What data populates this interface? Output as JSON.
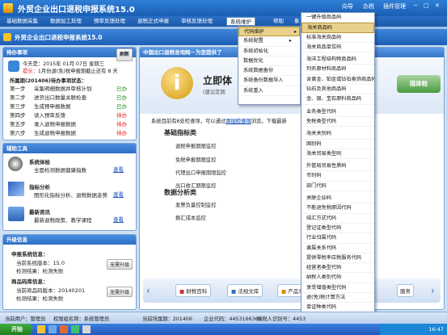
{
  "app": {
    "title": "外贸企业出口退税申报系统15.0",
    "right_links": [
      "向导",
      "办税",
      "插件管理"
    ]
  },
  "menu": {
    "items": [
      "基础数据采集",
      "数据加工处理",
      "预审反馈处理",
      "退税正式申报",
      "审核反馈处理",
      "系统维护",
      "帮助",
      "象"
    ]
  },
  "dropdown1": {
    "items": [
      "代码维护",
      "系统配置",
      "系统初始化",
      "数据优化",
      "系统数据备份",
      "系统备份数据导入",
      "系统重入"
    ]
  },
  "dropdown2": {
    "items": [
      "一键升级商品码",
      "海关商品码",
      "标准海关商品码",
      "海关商品单位码",
      "海洋工程结构物商品码",
      "列名原材料商品码",
      "含黄金、铂金或钻石类饰商品码",
      "钻石及其他商品码",
      "金、银、宝石原料商品码",
      "业务类型代码",
      "免税类型代码",
      "海关关别码",
      "国别码",
      "海关贸易类型码",
      "外管局贸易性质码",
      "币别码",
      "部门代码",
      "关联企业码",
      "不能退免税原因代码",
      "结汇方式代码",
      "登记证类型代码",
      "行业归属代码",
      "隶属关系代码",
      "提供零税率应税服务代码",
      "经营者类型代码",
      "纳税人类别代码",
      "享受增值类型代码",
      "退(免)税计算方法",
      "单证种类代码"
    ],
    "highlight_index": 1
  },
  "left": {
    "tasks": {
      "title": "待办事项",
      "refresh": "刷新",
      "today": "今天是：2015年 01月 07日 星期三",
      "reminder_prefix": "提示：",
      "reminder": "1月份退(免)税申报期截止还有 8 天",
      "period_label": "所属期(201406)待办事项状态：",
      "steps": [
        {
          "name": "第一步",
          "text": "采集明细数据并审核计划",
          "status": "已办"
        },
        {
          "name": "第二步",
          "text": "进货出口数量关联检查",
          "status": "已办"
        },
        {
          "name": "第三步",
          "text": "生成预申报数据",
          "status": "已办"
        },
        {
          "name": "第四步",
          "text": "读入预审反馈",
          "status": "待办"
        },
        {
          "name": "第五步",
          "text": "录入退税申报数据",
          "status": "待办"
        },
        {
          "name": "第六步",
          "text": "生成退税申报数据",
          "status": "待办"
        }
      ]
    },
    "tools": {
      "title": "辅助工具",
      "items": [
        {
          "name": "系统体检",
          "desc": "全面检测数据健康指数",
          "action": "查看"
        },
        {
          "name": "指标分析",
          "desc": "图形化指标分析、退税数据走势",
          "action": "查看"
        },
        {
          "name": "最新资讯",
          "desc": "最新退税政策、教学课程",
          "action": "查看"
        }
      ]
    },
    "upgrade": {
      "title": "升级信息",
      "app_label": "申报系统信息：",
      "app_ver": "当前系统版本：15.0",
      "app_check": "检测结果：检测失败",
      "app_btn": "无需升级",
      "code_label": "商品码库信息：",
      "code_ver": "当前商品码版本：20140201",
      "code_check": "检测结果：检测失败",
      "code_btn": "无需升级"
    }
  },
  "main": {
    "header": "中国出口退税咨询网－为您提供了",
    "icon_letter": "i",
    "headline": "立即体",
    "subline": "(建议定期",
    "scan_btn": "描体检",
    "hint_prefix": "系统目前有6处检查项，可以通过",
    "hint_link": "添加检查项",
    "hint_suffix": "浏览。下载最新",
    "basic_title": "基础指标类",
    "basic_items": [
      "退税申报期限监控",
      "免税申报期限监控",
      "代理出口申报期限监控",
      "出口收汇期限监控"
    ],
    "analysis_title": "数据分析类",
    "analysis_items": [
      "发票负量控制监控",
      "换汇成本监控"
    ],
    "bottom_btns": [
      "财税百科",
      "法规文库",
      "产品介"
    ],
    "service": "服务"
  },
  "status": {
    "user": "当前用户：管理员",
    "role": "权限组名称：系统管理员",
    "period": "当前所属期：201406",
    "tax_code": "企业代码：4453166365",
    "taxpayer": "纳税人识别号：4453"
  },
  "taskbar": {
    "start": "开始",
    "time": "16:47"
  }
}
